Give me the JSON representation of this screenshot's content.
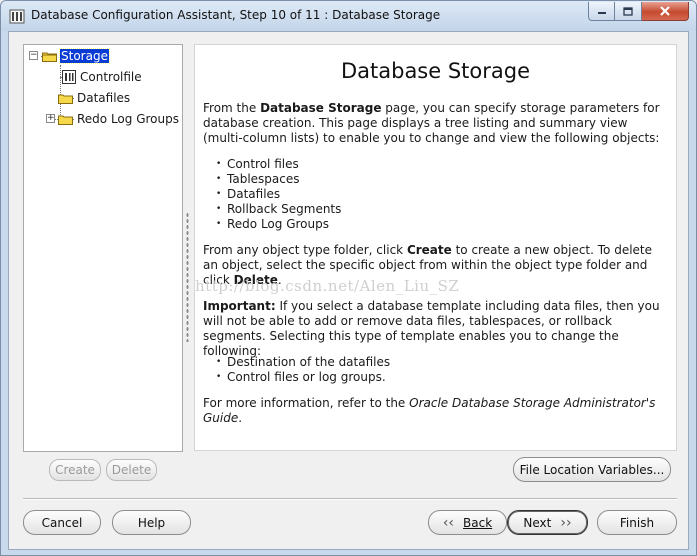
{
  "window": {
    "title": "Database Configuration Assistant, Step 10 of 11 : Database Storage"
  },
  "tree": {
    "root": "Storage",
    "children": [
      {
        "label": "Controlfile",
        "icon": "controlfile-icon"
      },
      {
        "label": "Datafiles",
        "icon": "folder-icon"
      },
      {
        "label": "Redo Log Groups",
        "icon": "folder-icon"
      }
    ],
    "buttons": {
      "create": "Create",
      "delete": "Delete"
    }
  },
  "content": {
    "title": "Database Storage",
    "intro_pre": "From the ",
    "intro_bold": "Database Storage",
    "intro_post": " page, you can specify storage parameters for database creation. This page displays a tree listing and summary view (multi-column lists) to enable you to change and view the following objects:",
    "objects": [
      "Control files",
      "Tablespaces",
      "Datafiles",
      "Rollback Segments",
      "Redo Log Groups"
    ],
    "create_pre": "From any object type folder, click ",
    "create_bold": "Create",
    "create_mid": " to create a new object. To delete an object, select the specific object from within the object type folder and click ",
    "create_bold2": "Delete",
    "create_post": ".",
    "important_bold": "Important:",
    "important_text": " If you select a database template including data files, then you will not be able to add or remove data files, tablespaces, or rollback segments. Selecting this type of template enables you to change the following:",
    "changes": [
      "Destination of the datafiles",
      "Control files or log groups."
    ],
    "more_pre": "For more information, refer to the ",
    "more_italic": "Oracle Database Storage Administrator's Guide",
    "more_post": ".",
    "watermark": "http://blog.csdn.net/Alen_Liu_SZ"
  },
  "buttons": {
    "file_location": "File Location Variables...",
    "cancel": "Cancel",
    "help": "Help",
    "back": "Back",
    "next": "Next",
    "finish": "Finish"
  },
  "colors": {
    "selection": "#0a3bd4",
    "window_frame": "#c9d9ec",
    "close_button": "#c54a2f"
  }
}
